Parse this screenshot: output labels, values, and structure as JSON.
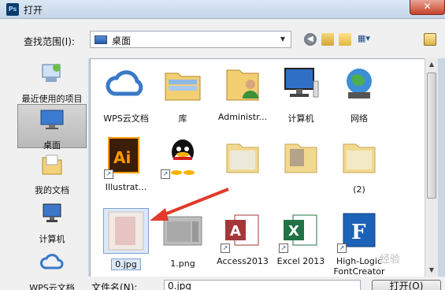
{
  "window": {
    "title": "打开",
    "app_icon": "photoshop-icon",
    "close_glyph": "✕"
  },
  "toolbar": {
    "look_in_label": "查找范围(I):",
    "location": "桌面",
    "buttons": [
      "back-icon",
      "up-folder-icon",
      "new-folder-icon",
      "view-menu-icon",
      "extra-icon"
    ]
  },
  "places": [
    {
      "label": "最近使用的项目",
      "icon": "recent-items-icon"
    },
    {
      "label": "桌面",
      "icon": "desktop-icon",
      "selected": true
    },
    {
      "label": "我的文档",
      "icon": "documents-icon"
    },
    {
      "label": "计算机",
      "icon": "computer-icon"
    },
    {
      "label": "WPS云文档",
      "icon": "wps-cloud-icon"
    }
  ],
  "files": [
    {
      "label": "WPS云文档",
      "icon": "wps-cloud-icon"
    },
    {
      "label": "库",
      "icon": "library-folder-icon"
    },
    {
      "label": "Administr...",
      "icon": "user-folder-icon"
    },
    {
      "label": "计算机",
      "icon": "computer-icon"
    },
    {
      "label": "网络",
      "icon": "network-icon"
    },
    {
      "label": "Illustrat...",
      "icon": "illustrator-shortcut-icon",
      "shortcut": true
    },
    {
      "label": "",
      "icon": "qq-shortcut-icon",
      "shortcut": true
    },
    {
      "label": "",
      "icon": "folder-icon"
    },
    {
      "label": "",
      "icon": "folder-icon"
    },
    {
      "label": "(2)",
      "icon": "folder-icon"
    },
    {
      "label": "0.jpg",
      "icon": "jpg-thumbnail-icon",
      "selected": true
    },
    {
      "label": "1.png",
      "icon": "png-thumbnail-icon"
    },
    {
      "label": "Access2013",
      "icon": "access-shortcut-icon",
      "shortcut": true
    },
    {
      "label": "Excel 2013",
      "icon": "excel-shortcut-icon",
      "shortcut": true
    },
    {
      "label": "High-Logic FontCreator",
      "icon": "fontcreator-shortcut-icon",
      "shortcut": true
    }
  ],
  "bottom": {
    "filename_label": "文件名(N):",
    "filename_value": "0.jpg",
    "open_button": "打开(O)"
  },
  "watermark": "经验",
  "colors": {
    "accent": "#3a79c7",
    "arrow": "#e23a2b",
    "selection": "#dde9f8"
  }
}
